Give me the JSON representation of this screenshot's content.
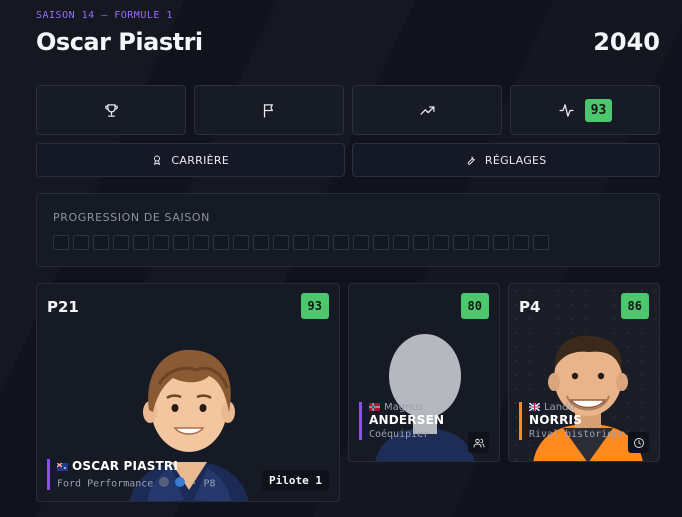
{
  "header": {
    "kicker": "SAISON 14 — FORMULE 1",
    "driver_name": "Oscar Piastri",
    "year": "2040"
  },
  "toolbar": {
    "icons": [
      "trophy-icon",
      "flag-icon",
      "trending-up-icon",
      "activity-icon"
    ],
    "rating": "93"
  },
  "actions": {
    "career_label": "CARRIÈRE",
    "settings_label": "RÉGLAGES"
  },
  "progress": {
    "label": "PROGRESSION DE SAISON",
    "total_races": 25,
    "completed_races": 0
  },
  "cards": {
    "main": {
      "position": "P21",
      "rating": "93",
      "nationality_flag": "australia",
      "name": "OSCAR PIASTRI",
      "team": "Ford Performance",
      "team_rank": "· P8",
      "role_tag": "Pilote 1",
      "accent": "#8a4dff"
    },
    "teammate": {
      "rating": "80",
      "nationality_flag": "norway",
      "first_name": "Magnus",
      "last_name": "ANDERSEN",
      "role": "Coéquipier",
      "accent": "#8a4dff"
    },
    "rival": {
      "position": "P4",
      "rating": "86",
      "nationality_flag": "united-kingdom",
      "first_name": "Lando",
      "last_name": "NORRIS",
      "role": "Rival historique",
      "accent": "#ff8a1f"
    }
  },
  "colors": {
    "background": "#10131c",
    "accent_purple": "#8a4dff",
    "rating_green": "#4cc76e",
    "mclaren_orange": "#ff8a1f"
  }
}
